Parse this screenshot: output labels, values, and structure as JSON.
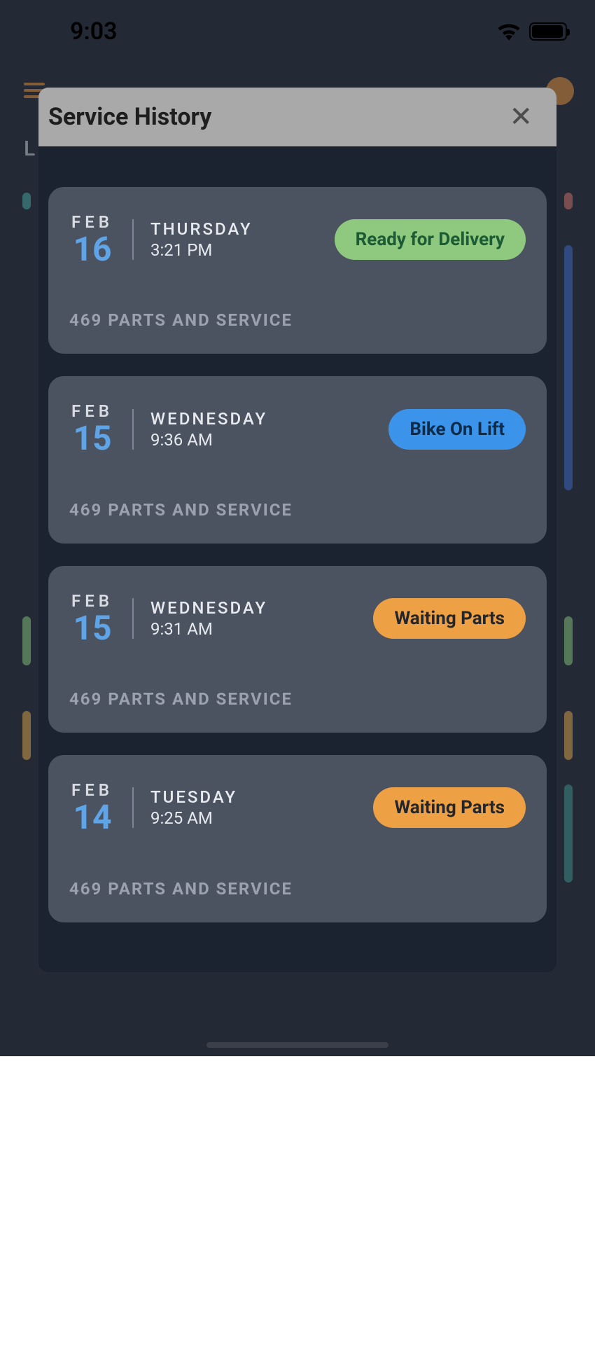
{
  "status": {
    "time": "9:03"
  },
  "modal": {
    "title": "Service History"
  },
  "entries": [
    {
      "month": "FEB",
      "day": "16",
      "weekday": "THURSDAY",
      "time": "3:21 PM",
      "status": "Ready for Delivery",
      "status_kind": "green",
      "shop": "469 PARTS AND SERVICE"
    },
    {
      "month": "FEB",
      "day": "15",
      "weekday": "WEDNESDAY",
      "time": "9:36 AM",
      "status": "Bike On Lift",
      "status_kind": "blue",
      "shop": "469 PARTS AND SERVICE"
    },
    {
      "month": "FEB",
      "day": "15",
      "weekday": "WEDNESDAY",
      "time": "9:31 AM",
      "status": "Waiting Parts",
      "status_kind": "orange",
      "shop": "469 PARTS AND SERVICE"
    },
    {
      "month": "FEB",
      "day": "14",
      "weekday": "TUESDAY",
      "time": "9:25 AM",
      "status": "Waiting Parts",
      "status_kind": "orange",
      "shop": "469 PARTS AND SERVICE"
    }
  ],
  "bg_letter": "L"
}
